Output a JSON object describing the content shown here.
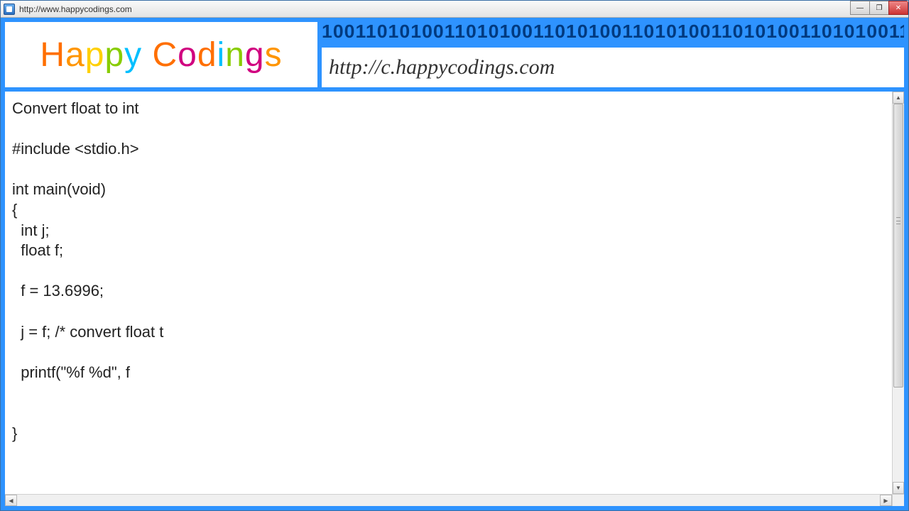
{
  "window": {
    "title": "http://www.happycodings.com"
  },
  "header": {
    "logo_text": "HappyCodings",
    "url": "http://c.happycodings.com"
  },
  "content": {
    "title": "Convert float to int",
    "code": "#include <stdio.h>\n\nint main(void)\n{\n  int j;\n  float f;\n\n  f = 13.6996;\n\n  j = f; /* convert float t\n\n  printf(\"%f %d\", f\n\n\n}"
  },
  "icons": {
    "minimize": "—",
    "maximize": "❐",
    "close": "✕",
    "up": "▲",
    "down": "▼",
    "left": "◀",
    "right": "▶"
  }
}
